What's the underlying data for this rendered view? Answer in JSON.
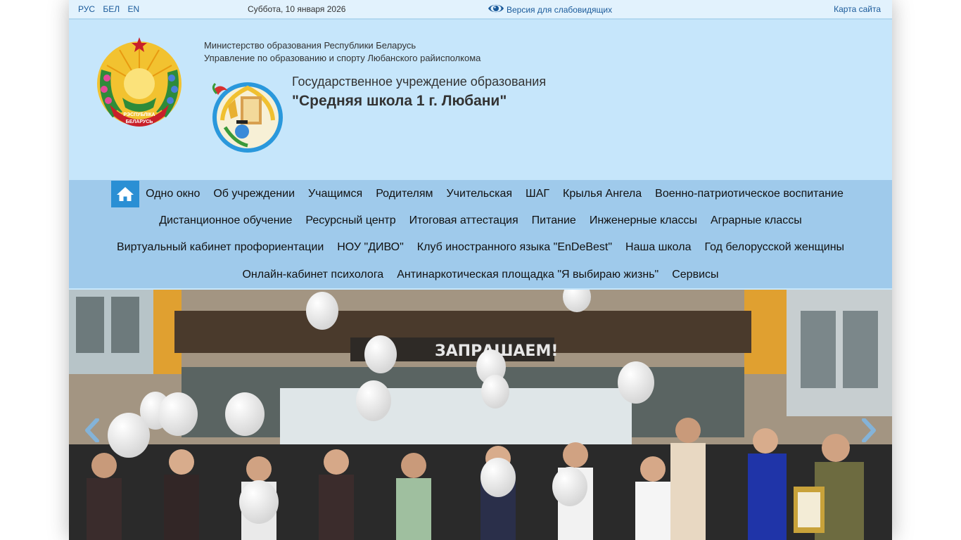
{
  "topbar": {
    "langs": [
      "РУС",
      "БЕЛ",
      "EN"
    ],
    "date": "Суббота, 10 января 2026",
    "low_vision": "Версия для слабовидящих",
    "sitemap": "Карта сайта"
  },
  "header": {
    "ministry": "Министерство образования Республики Беларусь",
    "department": "Управление по образованию и спорту Любанского райисполкома",
    "institution_type": "Государственное учреждение образования",
    "school_name": "\"Средняя школа 1 г. Любани\"",
    "coat_ribbon_top": "РЭСПУБЛІКА",
    "coat_ribbon_bottom": "БЕЛАРУСЬ"
  },
  "menu": {
    "row1": [
      "Одно окно",
      "Об учреждении",
      "Учащимся",
      "Родителям",
      "Учительская",
      "ШАГ",
      "Крылья Ангела",
      "Военно-патриотическое воспитание"
    ],
    "row2": [
      "Дистанционное обучение",
      "Ресурсный центр",
      "Итоговая аттестация",
      "Питание",
      "Инженерные классы",
      "Аграрные классы"
    ],
    "row3": [
      "Виртуальный кабинет профориентации",
      "НОУ \"ДИВО\"",
      "Клуб иностранного языка \"EnDeBest\"",
      "Наша школа",
      "Год белорусской женщины"
    ],
    "row4": [
      "Онлайн-кабинет психолога",
      "Антинаркотическая площадка \"Я выбираю жизнь\"",
      "Сервисы"
    ]
  },
  "slider": {
    "banner_text": "ЗАПРАШАЕМ!"
  },
  "colors": {
    "page_bg": "#c6e6fb",
    "menu_bg": "#9fcaeb",
    "home_btn": "#2a8fd4",
    "link": "#1a5a9a"
  }
}
